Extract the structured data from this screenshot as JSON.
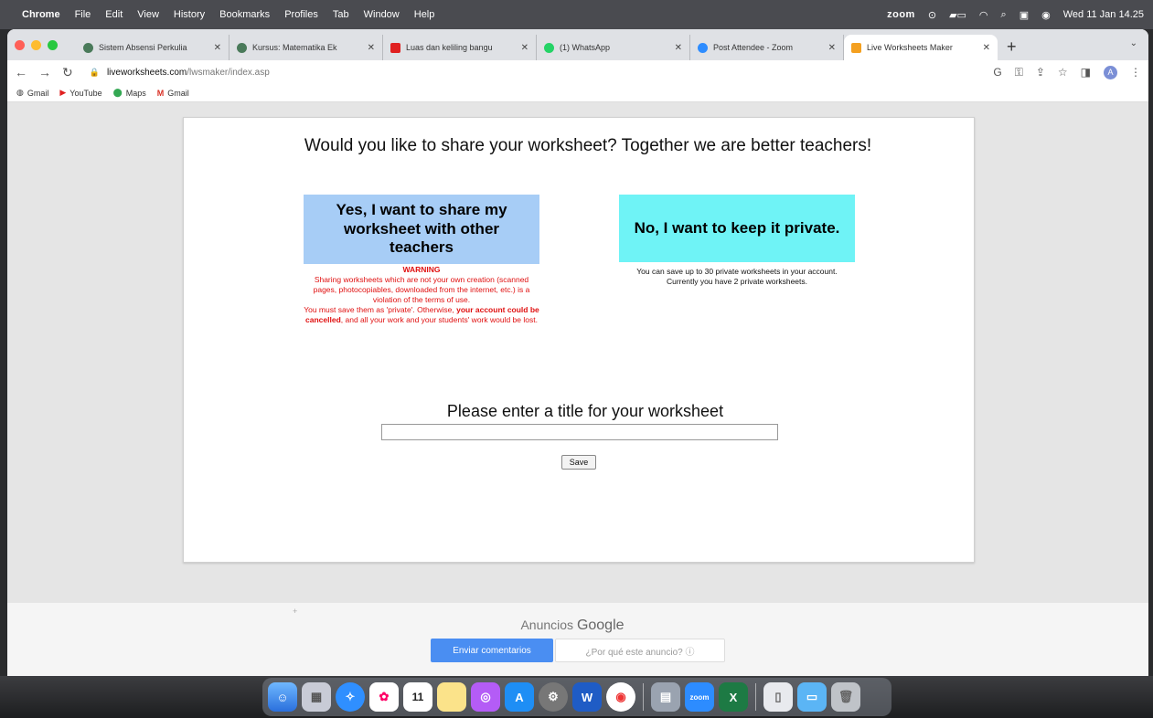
{
  "menubar": {
    "app": "Chrome",
    "items": [
      "File",
      "Edit",
      "View",
      "History",
      "Bookmarks",
      "Profiles",
      "Tab",
      "Window",
      "Help"
    ],
    "zoom": "zoom",
    "datetime": "Wed 11 Jan 14.25"
  },
  "tabs": [
    {
      "title": "Sistem Absensi Perkulia",
      "color": "#4a7a5a"
    },
    {
      "title": "Kursus: Matematika Ek",
      "color": "#4a7a5a"
    },
    {
      "title": "Luas dan keliling bangu",
      "color": "#e02020"
    },
    {
      "title": "(1) WhatsApp",
      "color": "#25d366"
    },
    {
      "title": "Post Attendee - Zoom",
      "color": "#2d8cff"
    },
    {
      "title": "Live Worksheets Maker",
      "color": "#f4a020"
    }
  ],
  "address": {
    "host": "liveworksheets.com",
    "path": "/lwsmaker/index.asp"
  },
  "bookmarks": [
    "Gmail",
    "YouTube",
    "Maps",
    "Gmail"
  ],
  "page": {
    "question": "Would you like to share your worksheet? Together we are better teachers!",
    "share_button": "Yes, I want to share my worksheet with other teachers",
    "private_button": "No, I want to keep it private.",
    "warning_title": "WARNING",
    "warning_text_1": "Sharing worksheets which are not your own creation (scanned pages, photocopiables, downloaded from the internet, etc.) is a violation of the terms of use.",
    "warning_text_2": "You must save them as 'private'. Otherwise,",
    "warning_bold": "your account could be cancelled",
    "warning_text_3": ", and all your work and your students' work would be lost.",
    "private_info_1": "You can save up to 30 private worksheets in your account.",
    "private_info_2": "Currently you have 2 private worksheets.",
    "title_label": "Please enter a title for your worksheet",
    "title_value": "",
    "save_label": "Save"
  },
  "ads": {
    "label": "Anuncios",
    "brand": "Google",
    "feedback_button": "Enviar comentarios",
    "why_button": "¿Por qué este anuncio? ⓘ"
  },
  "dock": {
    "calendar_day": "11"
  }
}
